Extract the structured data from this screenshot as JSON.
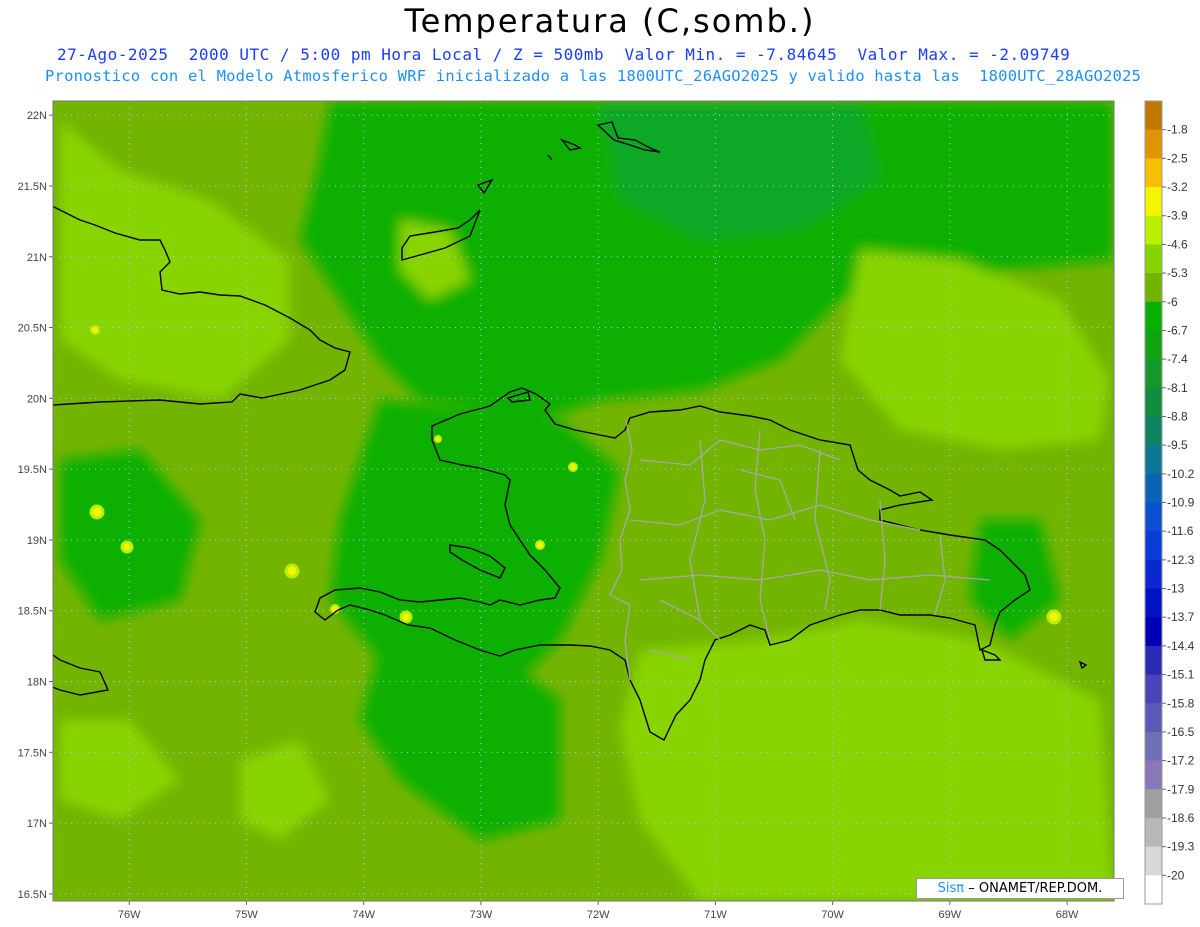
{
  "header": {
    "title": "Temperatura (C,somb.)",
    "line1": "27-Ago-2025  2000 UTC / 5:00 pm Hora Local / Z = 500mb  Valor Min. = -7.84645  Valor Max. = -2.09749",
    "line2": "Pronostico con el Modelo Atmosferico WRF inicializado a las 1800UTC_26AGO2025 y valido hasta las  1800UTC_28AGO2025"
  },
  "map": {
    "lat_labels": [
      "22N",
      "21.5N",
      "21N",
      "20.5N",
      "20N",
      "19.5N",
      "19N",
      "18.5N",
      "18N",
      "17.5N",
      "17N",
      "16.5N"
    ],
    "lat_values": [
      22,
      21.5,
      21,
      20.5,
      20,
      19.5,
      19,
      18.5,
      18,
      17.5,
      17,
      16.5
    ],
    "lon_labels": [
      "76W",
      "75W",
      "74W",
      "73W",
      "72W",
      "71W",
      "70W",
      "69W",
      "68W"
    ],
    "lon_values": [
      -76,
      -75,
      -74,
      -73,
      -72,
      -71,
      -70,
      -69,
      -68
    ],
    "lat_range": [
      16.45,
      22.1
    ],
    "lon_range": [
      -76.65,
      -67.6
    ]
  },
  "colorbar": {
    "labels": [
      "-1.8",
      "-2.5",
      "-3.2",
      "-3.9",
      "-4.6",
      "-5.3",
      "-6",
      "-6.7",
      "-7.4",
      "-8.1",
      "-8.8",
      "-9.5",
      "-10.2",
      "-10.9",
      "-11.6",
      "-12.3",
      "-13",
      "-13.7",
      "-14.4",
      "-15.1",
      "-15.8",
      "-16.5",
      "-17.2",
      "-17.9",
      "-18.6",
      "-19.3",
      "-20"
    ],
    "colors": [
      "#c07800",
      "#e09400",
      "#f5c000",
      "#f5f500",
      "#b8f000",
      "#88d400",
      "#72b400",
      "#08b000",
      "#10a410",
      "#149a2c",
      "#128c3e",
      "#108264",
      "#0a7894",
      "#0a62b4",
      "#0a50d0",
      "#0a3cd8",
      "#0a28d0",
      "#0012c4",
      "#0000b4",
      "#2a2ab4",
      "#4646b8",
      "#5a5ab8",
      "#7070b8",
      "#8878b8",
      "#a0a0a0",
      "#b8b8b8",
      "#d8d8d8",
      "#ffffff"
    ]
  },
  "credit": {
    "brand": "Sisπ",
    "text": "– ONAMET/REP.DOM."
  }
}
